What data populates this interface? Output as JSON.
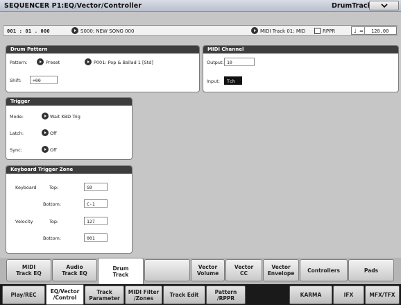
{
  "header": {
    "title": "SEQUENCER P1:EQ/Vector/Controller",
    "track_name": "DrumTrack"
  },
  "location": {
    "position": "001 : 01 . 000",
    "song": "S000: NEW SONG 000",
    "midi_track": "MIDI Track 01: MID",
    "rppr_label": "RPPR",
    "tempo_symbol": "♩",
    "tempo_eq": "=",
    "tempo": "120.00"
  },
  "drum_pattern": {
    "heading": "Drum Pattern",
    "pattern_label": "Pattern:",
    "pattern_bank": "Preset",
    "pattern_name": "P001: Pop & Ballad 1 [Std]",
    "shift_label": "Shift:",
    "shift_value": "+00"
  },
  "midi_channel": {
    "heading": "MIDI Channel",
    "output_label": "Output:",
    "output_value": "10",
    "input_label": "Input:",
    "input_value": "Tch"
  },
  "trigger": {
    "heading": "Trigger",
    "mode_label": "Mode:",
    "mode_value": "Wait KBD Trig",
    "latch_label": "Latch:",
    "latch_value": "Off",
    "sync_label": "Sync:",
    "sync_value": "Off"
  },
  "keyboard_trigger_zone": {
    "heading": "Keyboard Trigger Zone",
    "keyboard_label": "Keyboard",
    "velocity_label": "Velocity",
    "top_label": "Top:",
    "bottom_label": "Bottom:",
    "kbd_top": "G9",
    "kbd_bottom": "C-1",
    "vel_top": "127",
    "vel_bottom": "001"
  },
  "tabs_top": [
    {
      "label": "MIDI\nTrack EQ"
    },
    {
      "label": "Audio\nTrack EQ"
    },
    {
      "label": "Drum\nTrack"
    },
    {
      "label": ""
    },
    {
      "label": "Vector\nVolume"
    },
    {
      "label": "Vector\nCC"
    },
    {
      "label": "Vector\nEnvelope"
    },
    {
      "label": "Controllers"
    },
    {
      "label": "Pads"
    }
  ],
  "tabs_bottom": [
    {
      "label": "Play/REC"
    },
    {
      "label": "EQ/Vector\n/Control"
    },
    {
      "label": "Track\nParameter"
    },
    {
      "label": "MIDI Filter\n/Zones"
    },
    {
      "label": "Track Edit"
    },
    {
      "label": "Pattern\n/RPPR"
    },
    {
      "label": ""
    },
    {
      "label": "KARMA"
    },
    {
      "label": "IFX"
    },
    {
      "label": "MFX/TFX"
    }
  ],
  "colors": {
    "panel_header": "#3d3d3d",
    "page_bg": "#c6c6c6",
    "field_dark": "#111111"
  }
}
